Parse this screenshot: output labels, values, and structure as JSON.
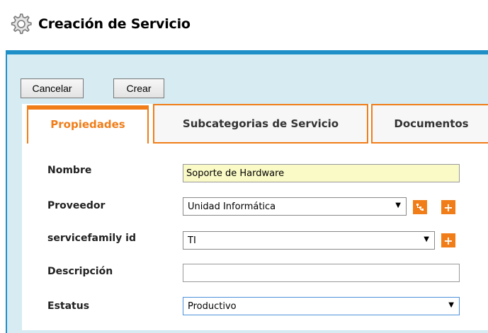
{
  "page": {
    "title": "Creación de Servicio",
    "icon": "gear-icon"
  },
  "toolbar": {
    "cancel_label": "Cancelar",
    "create_label": "Crear"
  },
  "tabs": [
    {
      "label": "Propiedades",
      "active": true
    },
    {
      "label": "Subcategorias de Servicio",
      "active": false
    },
    {
      "label": "Documentos",
      "active": false
    }
  ],
  "form": {
    "nombre": {
      "label": "Nombre",
      "value": "Soporte de Hardware"
    },
    "proveedor": {
      "label": "Proveedor",
      "value": "Unidad Informática"
    },
    "servicefamily": {
      "label": "servicefamily id",
      "value": "TI"
    },
    "descripcion": {
      "label": "Descripción",
      "value": ""
    },
    "estatus": {
      "label": "Estatus",
      "value": "Productivo"
    }
  },
  "colors": {
    "accent": "#f07d18",
    "panel_border": "#1e8fc7",
    "panel_bg": "#d6ecf2",
    "name_field_bg": "#fafac6"
  }
}
